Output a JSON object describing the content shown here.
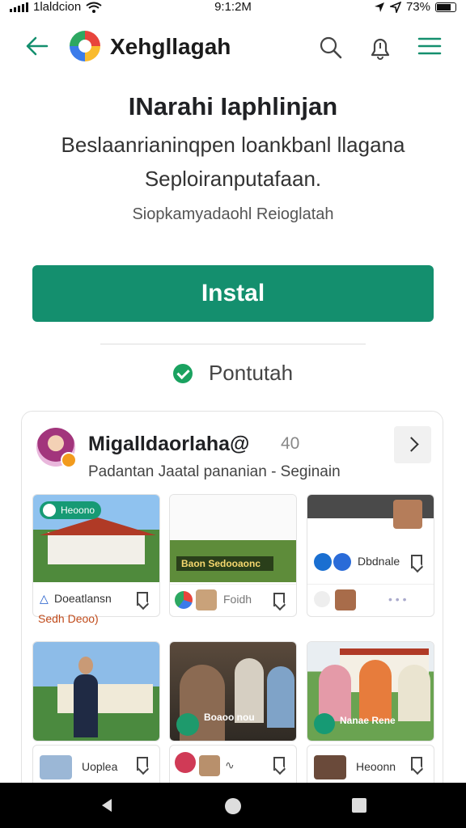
{
  "status_bar": {
    "carrier": "1laldcion",
    "time": "9:1:2M",
    "battery": "73%"
  },
  "app_bar": {
    "title": "Xehgllagah",
    "icons": [
      "back-arrow-icon",
      "search-icon",
      "notification-icon",
      "menu-icon"
    ]
  },
  "hero": {
    "title": "INarahi Iaphlinjan",
    "description": "Beslaanrianinqpen loankbanl llagana Seploiranputafaan.",
    "subtitle": "Siopkamyadaohl Reioglatah"
  },
  "install_label": "Instal",
  "verified_label": "Pontutah",
  "colors": {
    "accent": "#148f6e",
    "verified": "#1aa260"
  },
  "channel": {
    "name": "Migalldaorlaha@",
    "count": "40",
    "meta": "Padantan Jaatal pananian  -  Seginain"
  },
  "tiles": [
    {
      "badge": "Heoono",
      "caption": "Doeatlansn",
      "caption2": "Sedh Deoo)"
    },
    {
      "badge": "Baon Sedooaonc",
      "caption": "Foidh"
    },
    {
      "badge": "",
      "caption": "Dbdnale",
      "caption2": ""
    },
    {
      "badge": "",
      "caption": "",
      "caption2": ""
    },
    {
      "badge": "Boaoo nou",
      "caption": ""
    },
    {
      "badge": "Nanae Rene",
      "caption": "Heoonn"
    },
    {
      "caption": "Uoplea"
    }
  ]
}
